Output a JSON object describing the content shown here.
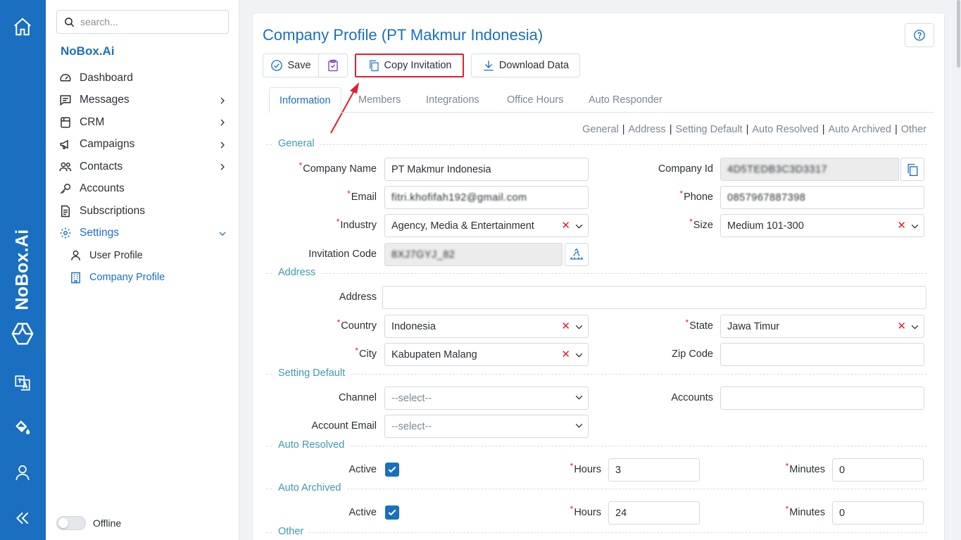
{
  "rail": {
    "brand": "NoBox.Ai",
    "icons": [
      "home-icon",
      "logo-cube-icon",
      "translate-icon",
      "paint-bucket-icon",
      "user-icon",
      "collapse-icon"
    ]
  },
  "sidebar": {
    "search_placeholder": "search...",
    "org_name": "NoBox.Ai",
    "items": [
      {
        "label": "Dashboard",
        "icon": "gauge-icon"
      },
      {
        "label": "Messages",
        "icon": "message-icon"
      },
      {
        "label": "CRM",
        "icon": "crm-icon"
      },
      {
        "label": "Campaigns",
        "icon": "megaphone-icon"
      },
      {
        "label": "Contacts",
        "icon": "contacts-icon"
      },
      {
        "label": "Accounts",
        "icon": "key-icon"
      },
      {
        "label": "Subscriptions",
        "icon": "document-icon"
      },
      {
        "label": "Settings",
        "icon": "gear-icon"
      },
      {
        "label": "User Profile",
        "icon": "user-icon"
      },
      {
        "label": "Company Profile",
        "icon": "building-icon"
      }
    ],
    "status_label": "Offline"
  },
  "page": {
    "title": "Company Profile (PT Makmur Indonesia)",
    "toolbar": {
      "save": "Save",
      "copy_invitation": "Copy Invitation",
      "download_data": "Download Data"
    },
    "tabs": [
      "Information",
      "Members",
      "Integrations",
      "Office Hours",
      "Auto Responder"
    ],
    "sublinks": [
      "General",
      "Address",
      "Setting Default",
      "Auto Resolved",
      "Auto Archived",
      "Other"
    ],
    "sections": {
      "general": "General",
      "address": "Address",
      "setting_default": "Setting Default",
      "auto_resolved": "Auto Resolved",
      "auto_archived": "Auto Archived",
      "other": "Other"
    },
    "labels": {
      "company_name": "Company Name",
      "company_id": "Company Id",
      "email": "Email",
      "phone": "Phone",
      "industry": "Industry",
      "size": "Size",
      "invitation_code": "Invitation Code",
      "address": "Address",
      "country": "Country",
      "state": "State",
      "city": "City",
      "zip_code": "Zip Code",
      "channel": "Channel",
      "accounts": "Accounts",
      "account_email": "Account Email",
      "active": "Active",
      "hours": "Hours",
      "minutes": "Minutes"
    },
    "values": {
      "company_name": "PT Makmur Indonesia",
      "company_id": "4D5TEDB3C3D3317",
      "email": "fitri.khofifah192@gmail.com",
      "phone": "0857967887398",
      "industry": "Agency, Media & Entertainment",
      "size": "Medium 101-300",
      "invitation_code": "8XJ7GYJ_82",
      "address": "",
      "country": "Indonesia",
      "state": "Jawa Timur",
      "city": "Kabupaten Malang",
      "zip_code": "",
      "channel_placeholder": "--select--",
      "accounts": "",
      "account_email_placeholder": "--select--",
      "auto_resolved_hours": "3",
      "auto_resolved_minutes": "0",
      "auto_archived_hours": "24",
      "auto_archived_minutes": "0"
    }
  },
  "colors": {
    "brand": "#1a6fc0",
    "section": "#3d9ab1",
    "required": "#e0202a",
    "highlight": "#e0202a"
  }
}
